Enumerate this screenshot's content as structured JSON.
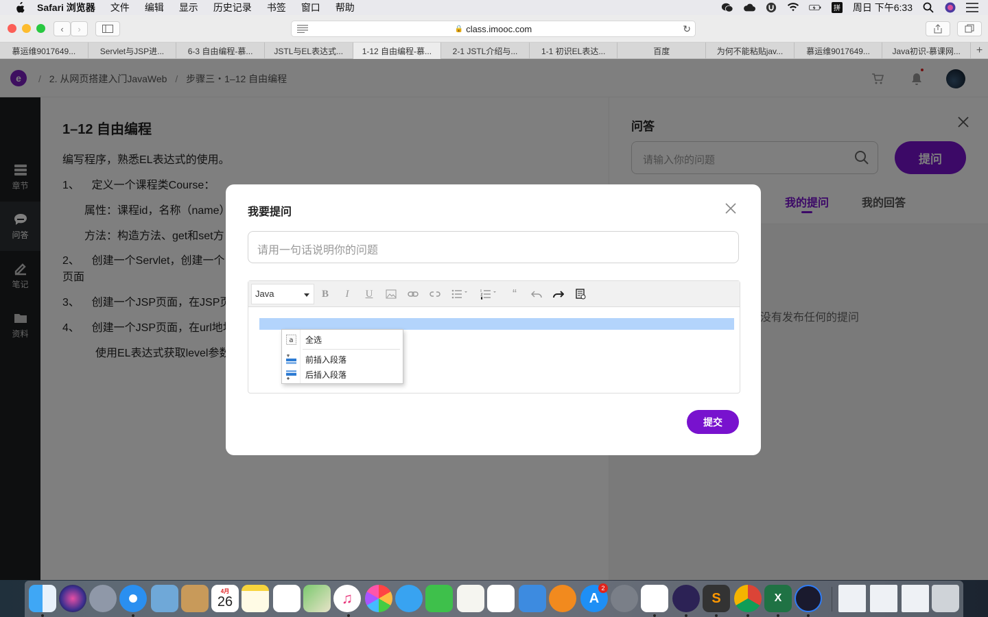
{
  "menubar": {
    "app_name": "Safari 浏览器",
    "items": [
      "文件",
      "编辑",
      "显示",
      "历史记录",
      "书签",
      "窗口",
      "帮助"
    ],
    "clock": "周日 下午6:33"
  },
  "browser": {
    "url": "class.imooc.com",
    "tabs": [
      "慕运维9017649...",
      "Servlet与JSP进...",
      "6-3 自由编程-慕...",
      "JSTL与EL表达式...",
      "1-12 自由编程-慕...",
      "2-1 JSTL介绍与...",
      "1-1 初识EL表达...",
      "百度",
      "为何不能粘贴jav...",
      "慕运维9017649...",
      "Java初识-慕课网..."
    ],
    "active_tab": 4,
    "new_tab_label": "+"
  },
  "header": {
    "logo_letter": "e",
    "crumb_sep": "/",
    "crumb_course": "2. 从网页搭建入门JavaWeb",
    "crumb_step": "步骤三・1–12 自由编程"
  },
  "sidebar": {
    "items": [
      {
        "label": "章节",
        "icon": "list-icon"
      },
      {
        "label": "问答",
        "icon": "chat-icon"
      },
      {
        "label": "笔记",
        "icon": "pencil-icon"
      },
      {
        "label": "资料",
        "icon": "folder-icon"
      }
    ]
  },
  "content": {
    "title": "1–12 自由编程",
    "lines": [
      "编写程序，熟悉EL表达式的使用。",
      "1、    定义一个课程类Course：",
      "属性：课程id，名称（name）",
      "方法：构造方法、get和set方",
      "2、    创建一个Servlet，创建一个",
      "页面",
      "3、    创建一个JSP页面，在JSP页",
      "4、    创建一个JSP页面，在url地址",
      "使用EL表达式获取level参数"
    ]
  },
  "qa": {
    "title": "问答",
    "search_placeholder": "请输入你的问题",
    "ask_button": "提问",
    "tab_mine": "我的提问",
    "tab_answers": "我的回答",
    "empty_text": "没有发布任何的提问"
  },
  "modal": {
    "title": "我要提问",
    "input_placeholder": "请用一句话说明你的问题",
    "language": "Java",
    "submit": "提交",
    "context_menu": [
      "全选",
      "前插入段落",
      "后插入段落"
    ],
    "toolbar_glyphs": {
      "bold": "B",
      "italic": "I",
      "underline": "U",
      "quote": "“"
    }
  },
  "dock": {
    "calendar_month": "4月",
    "calendar_day": "26",
    "appstore_badge": "2"
  },
  "colors": {
    "brand_purple": "#7812ce",
    "selection_blue": "#b3d4fc"
  }
}
